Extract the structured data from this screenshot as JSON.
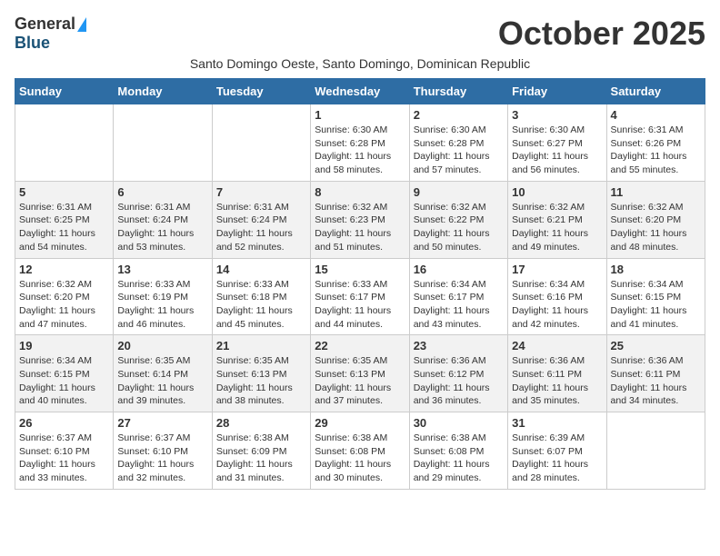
{
  "header": {
    "logo_general": "General",
    "logo_blue": "Blue",
    "month_title": "October 2025",
    "subtitle": "Santo Domingo Oeste, Santo Domingo, Dominican Republic"
  },
  "days_of_week": [
    "Sunday",
    "Monday",
    "Tuesday",
    "Wednesday",
    "Thursday",
    "Friday",
    "Saturday"
  ],
  "weeks": [
    [
      {
        "day": "",
        "info": ""
      },
      {
        "day": "",
        "info": ""
      },
      {
        "day": "",
        "info": ""
      },
      {
        "day": "1",
        "info": "Sunrise: 6:30 AM\nSunset: 6:28 PM\nDaylight: 11 hours\nand 58 minutes."
      },
      {
        "day": "2",
        "info": "Sunrise: 6:30 AM\nSunset: 6:28 PM\nDaylight: 11 hours\nand 57 minutes."
      },
      {
        "day": "3",
        "info": "Sunrise: 6:30 AM\nSunset: 6:27 PM\nDaylight: 11 hours\nand 56 minutes."
      },
      {
        "day": "4",
        "info": "Sunrise: 6:31 AM\nSunset: 6:26 PM\nDaylight: 11 hours\nand 55 minutes."
      }
    ],
    [
      {
        "day": "5",
        "info": "Sunrise: 6:31 AM\nSunset: 6:25 PM\nDaylight: 11 hours\nand 54 minutes."
      },
      {
        "day": "6",
        "info": "Sunrise: 6:31 AM\nSunset: 6:24 PM\nDaylight: 11 hours\nand 53 minutes."
      },
      {
        "day": "7",
        "info": "Sunrise: 6:31 AM\nSunset: 6:24 PM\nDaylight: 11 hours\nand 52 minutes."
      },
      {
        "day": "8",
        "info": "Sunrise: 6:32 AM\nSunset: 6:23 PM\nDaylight: 11 hours\nand 51 minutes."
      },
      {
        "day": "9",
        "info": "Sunrise: 6:32 AM\nSunset: 6:22 PM\nDaylight: 11 hours\nand 50 minutes."
      },
      {
        "day": "10",
        "info": "Sunrise: 6:32 AM\nSunset: 6:21 PM\nDaylight: 11 hours\nand 49 minutes."
      },
      {
        "day": "11",
        "info": "Sunrise: 6:32 AM\nSunset: 6:20 PM\nDaylight: 11 hours\nand 48 minutes."
      }
    ],
    [
      {
        "day": "12",
        "info": "Sunrise: 6:32 AM\nSunset: 6:20 PM\nDaylight: 11 hours\nand 47 minutes."
      },
      {
        "day": "13",
        "info": "Sunrise: 6:33 AM\nSunset: 6:19 PM\nDaylight: 11 hours\nand 46 minutes."
      },
      {
        "day": "14",
        "info": "Sunrise: 6:33 AM\nSunset: 6:18 PM\nDaylight: 11 hours\nand 45 minutes."
      },
      {
        "day": "15",
        "info": "Sunrise: 6:33 AM\nSunset: 6:17 PM\nDaylight: 11 hours\nand 44 minutes."
      },
      {
        "day": "16",
        "info": "Sunrise: 6:34 AM\nSunset: 6:17 PM\nDaylight: 11 hours\nand 43 minutes."
      },
      {
        "day": "17",
        "info": "Sunrise: 6:34 AM\nSunset: 6:16 PM\nDaylight: 11 hours\nand 42 minutes."
      },
      {
        "day": "18",
        "info": "Sunrise: 6:34 AM\nSunset: 6:15 PM\nDaylight: 11 hours\nand 41 minutes."
      }
    ],
    [
      {
        "day": "19",
        "info": "Sunrise: 6:34 AM\nSunset: 6:15 PM\nDaylight: 11 hours\nand 40 minutes."
      },
      {
        "day": "20",
        "info": "Sunrise: 6:35 AM\nSunset: 6:14 PM\nDaylight: 11 hours\nand 39 minutes."
      },
      {
        "day": "21",
        "info": "Sunrise: 6:35 AM\nSunset: 6:13 PM\nDaylight: 11 hours\nand 38 minutes."
      },
      {
        "day": "22",
        "info": "Sunrise: 6:35 AM\nSunset: 6:13 PM\nDaylight: 11 hours\nand 37 minutes."
      },
      {
        "day": "23",
        "info": "Sunrise: 6:36 AM\nSunset: 6:12 PM\nDaylight: 11 hours\nand 36 minutes."
      },
      {
        "day": "24",
        "info": "Sunrise: 6:36 AM\nSunset: 6:11 PM\nDaylight: 11 hours\nand 35 minutes."
      },
      {
        "day": "25",
        "info": "Sunrise: 6:36 AM\nSunset: 6:11 PM\nDaylight: 11 hours\nand 34 minutes."
      }
    ],
    [
      {
        "day": "26",
        "info": "Sunrise: 6:37 AM\nSunset: 6:10 PM\nDaylight: 11 hours\nand 33 minutes."
      },
      {
        "day": "27",
        "info": "Sunrise: 6:37 AM\nSunset: 6:10 PM\nDaylight: 11 hours\nand 32 minutes."
      },
      {
        "day": "28",
        "info": "Sunrise: 6:38 AM\nSunset: 6:09 PM\nDaylight: 11 hours\nand 31 minutes."
      },
      {
        "day": "29",
        "info": "Sunrise: 6:38 AM\nSunset: 6:08 PM\nDaylight: 11 hours\nand 30 minutes."
      },
      {
        "day": "30",
        "info": "Sunrise: 6:38 AM\nSunset: 6:08 PM\nDaylight: 11 hours\nand 29 minutes."
      },
      {
        "day": "31",
        "info": "Sunrise: 6:39 AM\nSunset: 6:07 PM\nDaylight: 11 hours\nand 28 minutes."
      },
      {
        "day": "",
        "info": ""
      }
    ]
  ]
}
